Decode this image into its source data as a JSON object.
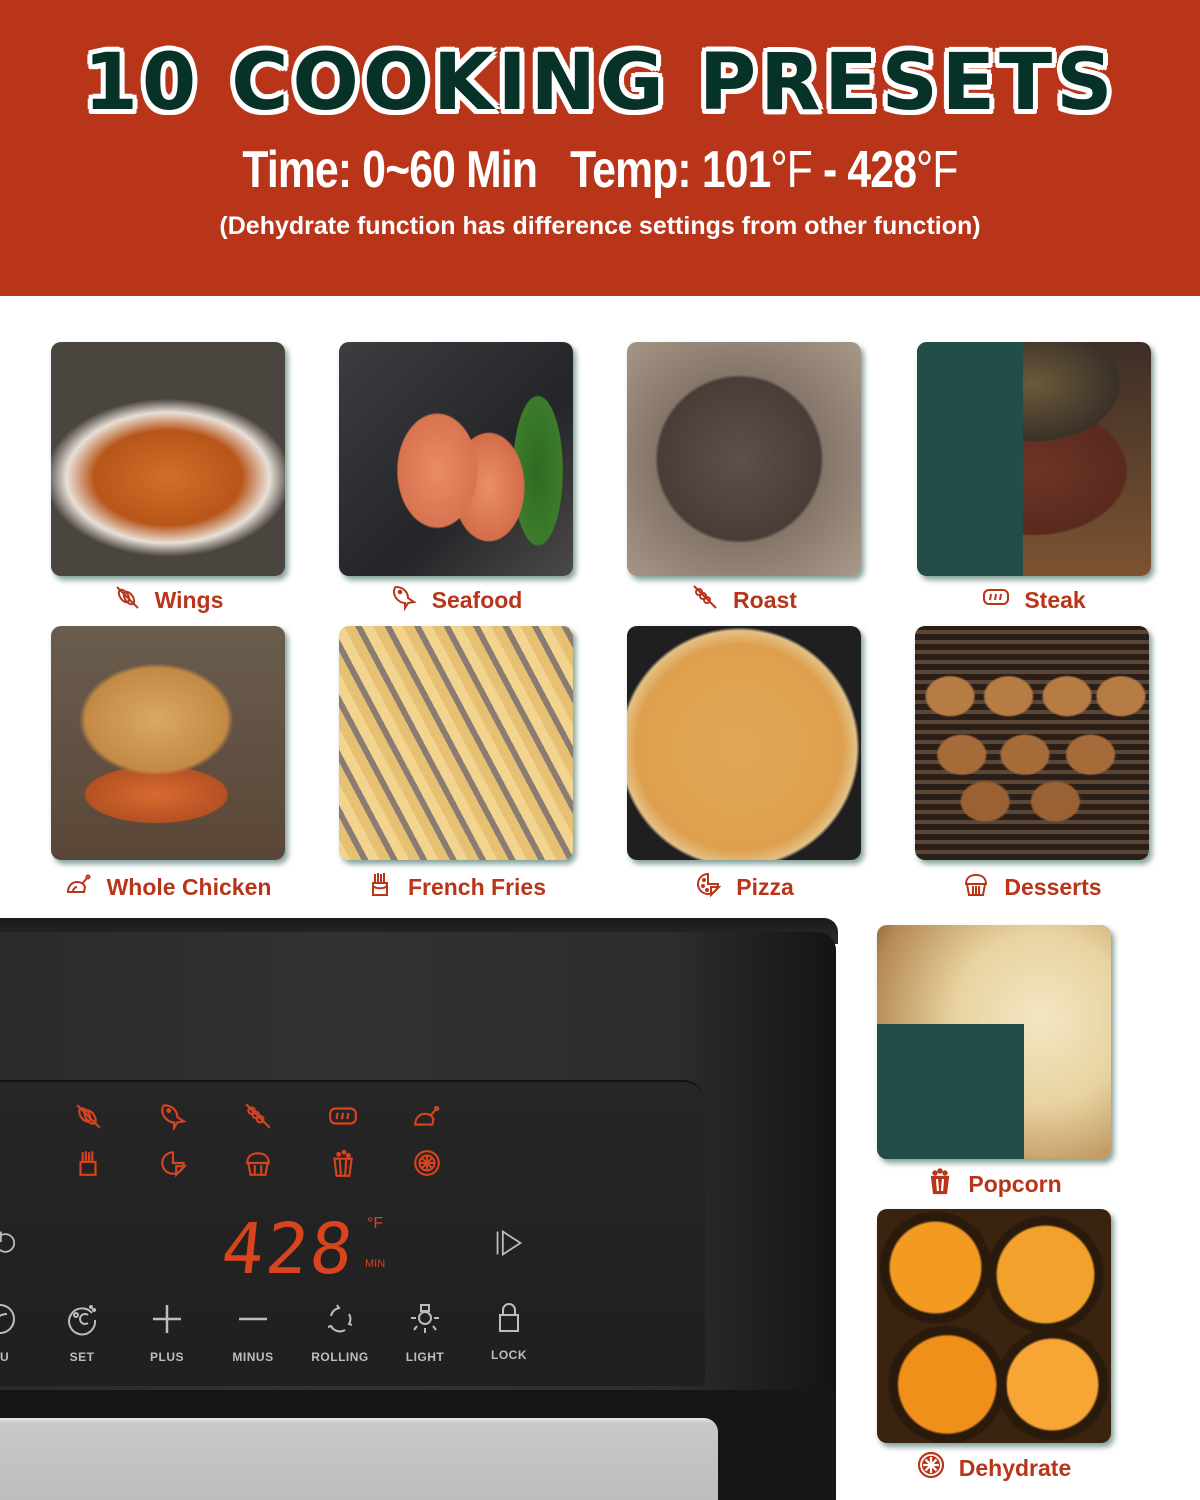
{
  "header": {
    "title": "10 COOKING PRESETS",
    "time_text": "Time: 0~60 Min",
    "temp_prefix": "Temp: ",
    "temp_low": "101",
    "temp_high": "428",
    "degree_unit": "°F",
    "temp_separator": " - ",
    "note": "(Dehydrate function has difference settings from other function)"
  },
  "colors": {
    "header_bg": "#b9351a",
    "title_fill": "#073228",
    "accent_label": "#b9351a",
    "panel_led": "#d9431e",
    "green_block": "#224e47"
  },
  "presets": [
    {
      "label": "Wings",
      "icon": "wings-icon"
    },
    {
      "label": "Seafood",
      "icon": "fish-icon"
    },
    {
      "label": "Roast",
      "icon": "skewer-icon"
    },
    {
      "label": "Steak",
      "icon": "steak-icon"
    },
    {
      "label": "Whole Chicken",
      "icon": "chicken-icon"
    },
    {
      "label": "French Fries",
      "icon": "fries-icon"
    },
    {
      "label": "Pizza",
      "icon": "pizza-icon"
    },
    {
      "label": "Desserts",
      "icon": "muffin-icon"
    },
    {
      "label": "Popcorn",
      "icon": "popcorn-icon"
    },
    {
      "label": "Dehydrate",
      "icon": "orange-slice-icon"
    }
  ],
  "control_panel": {
    "display_value": "428",
    "unit_temp": "°F",
    "unit_time": "MIN",
    "buttons": [
      {
        "label": "NU",
        "icon": "menu-icon"
      },
      {
        "label": "SET",
        "icon": "set-temp-icon"
      },
      {
        "label": "PLUS",
        "icon": "plus-icon"
      },
      {
        "label": "MINUS",
        "icon": "minus-icon"
      },
      {
        "label": "ROLLING",
        "icon": "rolling-icon"
      },
      {
        "label": "LIGHT",
        "icon": "light-icon"
      },
      {
        "label": "LOCK",
        "icon": "lock-icon"
      }
    ],
    "power_icon": "power-icon",
    "start_icon": "start-pause-icon"
  }
}
